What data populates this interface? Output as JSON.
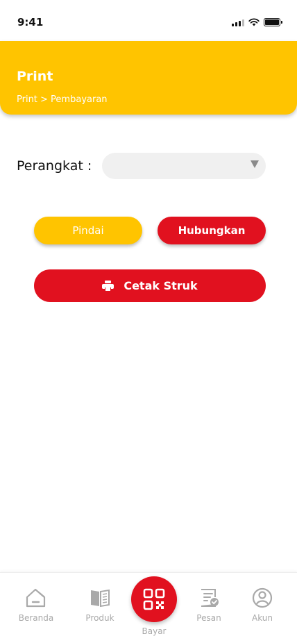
{
  "status_bar": {
    "time": "9:41"
  },
  "header": {
    "title": "Print",
    "breadcrumb": "Print > Pembayaran"
  },
  "device": {
    "label": "Perangkat :",
    "selected_value": ""
  },
  "buttons": {
    "scan": "Pindai",
    "connect": "Hubungkan",
    "print": "Cetak Struk"
  },
  "nav": {
    "items": [
      {
        "label": "Beranda",
        "icon": "home-icon"
      },
      {
        "label": "Produk",
        "icon": "book-icon"
      },
      {
        "label": "Bayar",
        "icon": "qr-code-icon"
      },
      {
        "label": "Pesan",
        "icon": "order-check-icon"
      },
      {
        "label": "Akun",
        "icon": "user-circle-icon"
      }
    ]
  },
  "colors": {
    "primary_yellow": "#FFC400",
    "primary_red": "#E1111F",
    "inactive_gray": "#a9a9a9"
  }
}
